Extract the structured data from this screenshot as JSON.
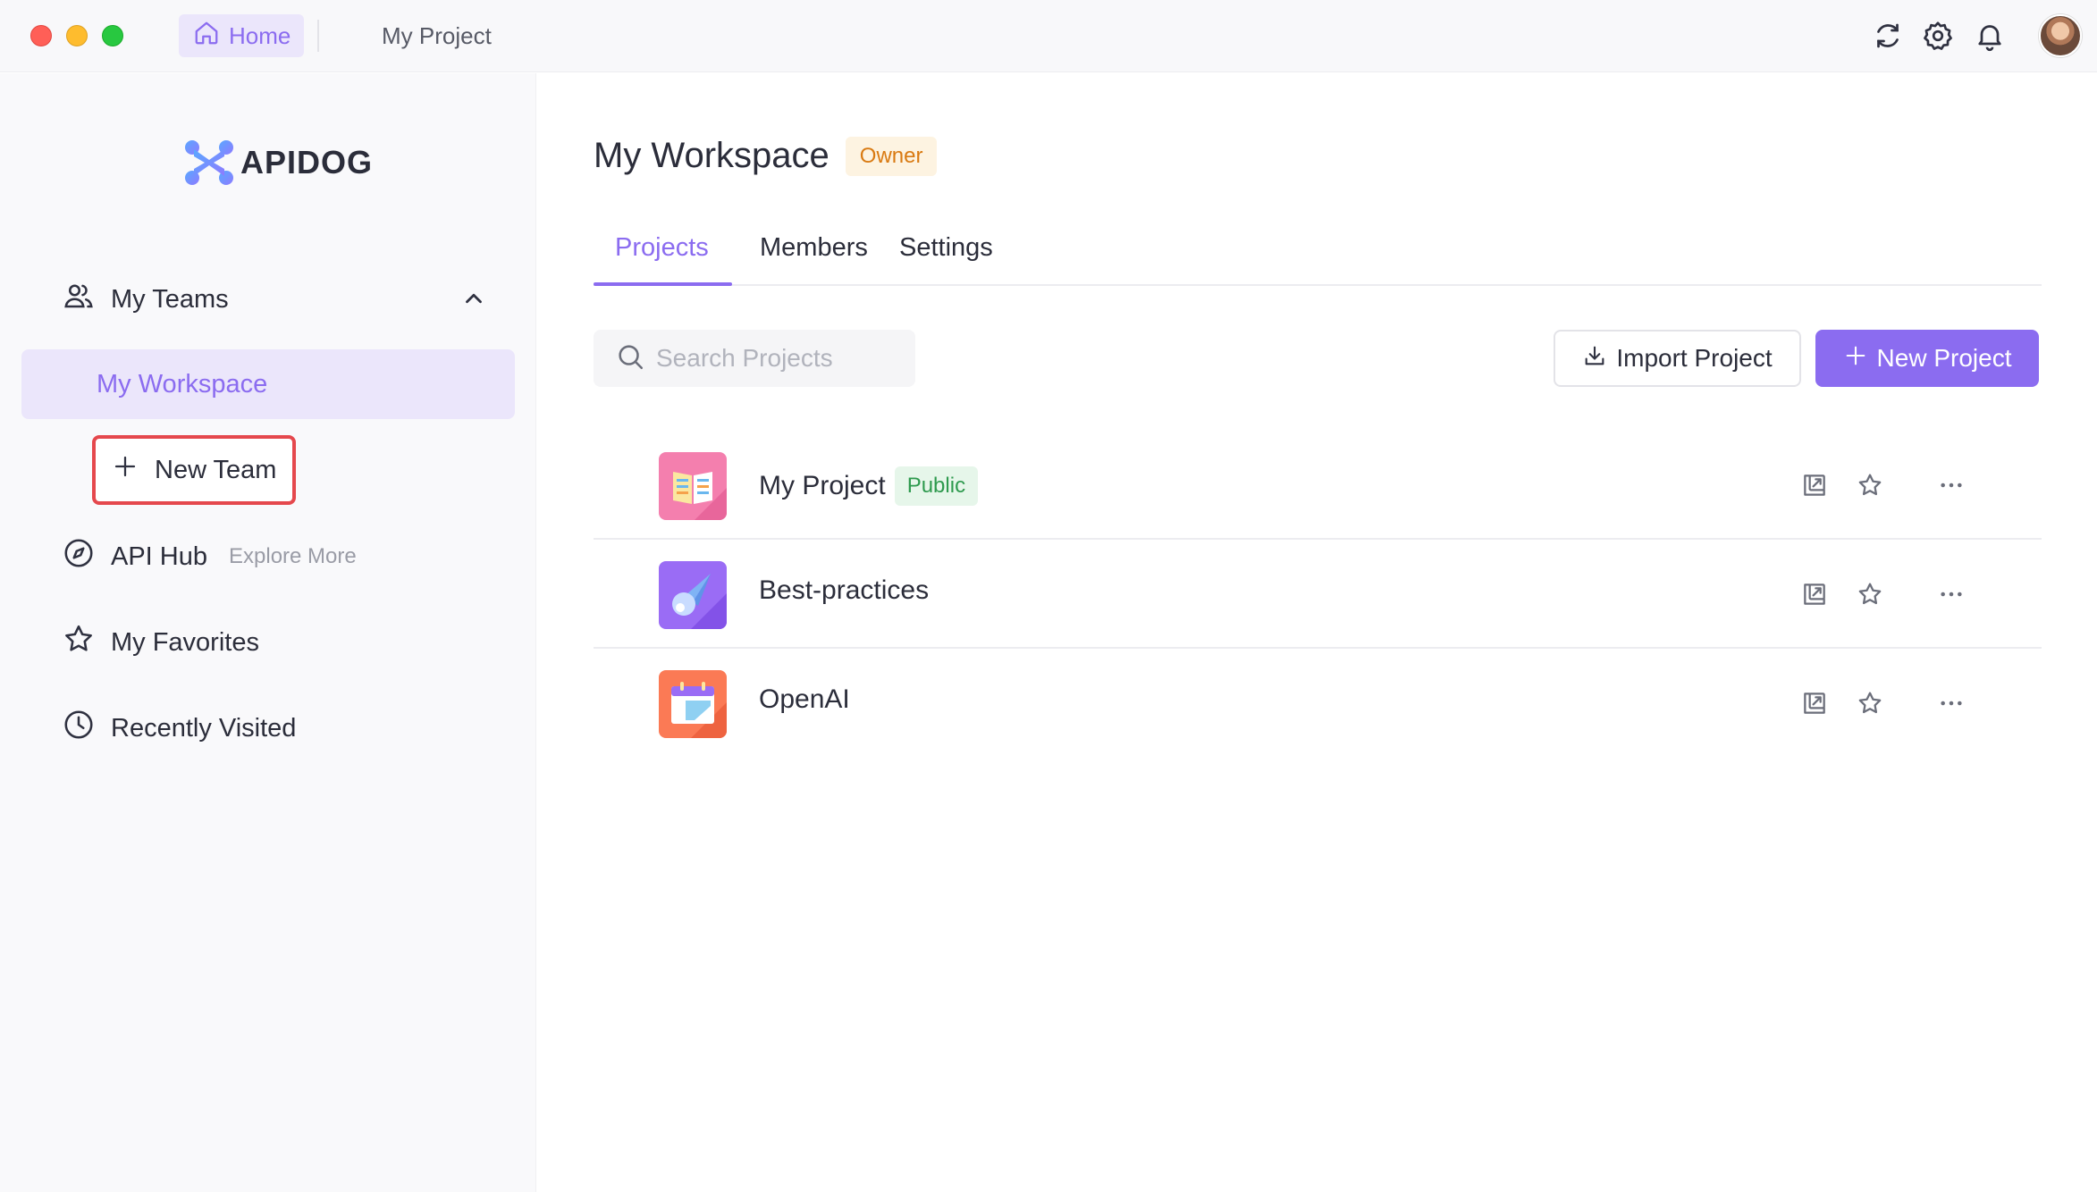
{
  "titlebar": {
    "home_label": "Home",
    "project_tab": "My Project",
    "icons": [
      "sync-icon",
      "gear-icon",
      "bell-icon"
    ]
  },
  "sidebar": {
    "logo_text": "APIDOG",
    "my_teams": "My Teams",
    "workspace": "My Workspace",
    "new_team": "New Team",
    "api_hub": "API Hub",
    "explore_more": "Explore More",
    "favorites": "My Favorites",
    "recent": "Recently Visited"
  },
  "main": {
    "title": "My Workspace",
    "owner_badge": "Owner",
    "tabs": [
      {
        "label": "Projects",
        "active": true
      },
      {
        "label": "Members",
        "active": false
      },
      {
        "label": "Settings",
        "active": false
      }
    ],
    "search_placeholder": "Search Projects",
    "import_label": "Import Project",
    "new_label": "New Project",
    "projects": [
      {
        "name": "My Project",
        "badge": "Public",
        "icon": "book-icon"
      },
      {
        "name": "Best-practices",
        "badge": "",
        "icon": "comet-icon"
      },
      {
        "name": "OpenAI",
        "badge": "",
        "icon": "calendar-icon"
      }
    ]
  },
  "colors": {
    "accent": "#8b6cf0",
    "accent_bg": "#ebe6fb",
    "owner": "#d97a12",
    "public": "#2e9a4e",
    "highlight_border": "#e5484d"
  }
}
